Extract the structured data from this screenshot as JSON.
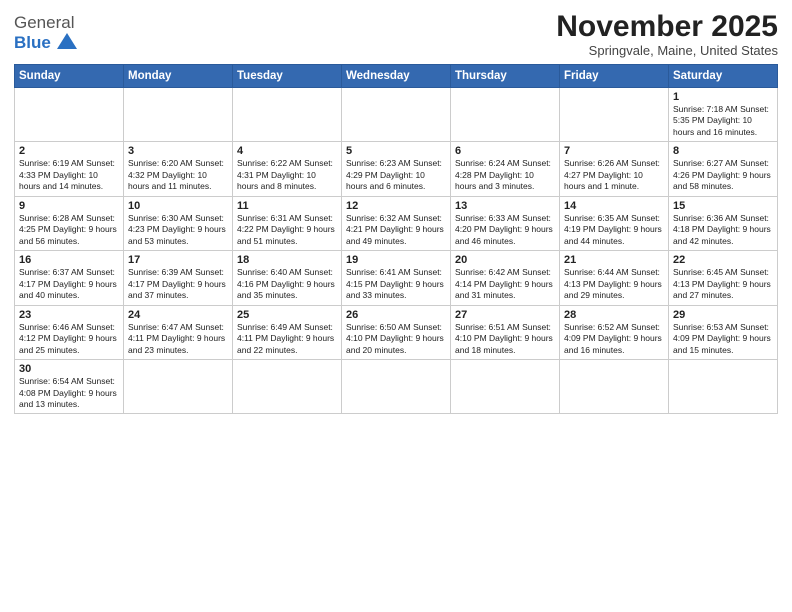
{
  "logo": {
    "text_general": "General",
    "text_blue": "Blue"
  },
  "title": "November 2025",
  "location": "Springvale, Maine, United States",
  "days_of_week": [
    "Sunday",
    "Monday",
    "Tuesday",
    "Wednesday",
    "Thursday",
    "Friday",
    "Saturday"
  ],
  "weeks": [
    [
      {
        "day": "",
        "info": ""
      },
      {
        "day": "",
        "info": ""
      },
      {
        "day": "",
        "info": ""
      },
      {
        "day": "",
        "info": ""
      },
      {
        "day": "",
        "info": ""
      },
      {
        "day": "",
        "info": ""
      },
      {
        "day": "1",
        "info": "Sunrise: 7:18 AM\nSunset: 5:35 PM\nDaylight: 10 hours\nand 16 minutes."
      }
    ],
    [
      {
        "day": "2",
        "info": "Sunrise: 6:19 AM\nSunset: 4:33 PM\nDaylight: 10 hours\nand 14 minutes."
      },
      {
        "day": "3",
        "info": "Sunrise: 6:20 AM\nSunset: 4:32 PM\nDaylight: 10 hours\nand 11 minutes."
      },
      {
        "day": "4",
        "info": "Sunrise: 6:22 AM\nSunset: 4:31 PM\nDaylight: 10 hours\nand 8 minutes."
      },
      {
        "day": "5",
        "info": "Sunrise: 6:23 AM\nSunset: 4:29 PM\nDaylight: 10 hours\nand 6 minutes."
      },
      {
        "day": "6",
        "info": "Sunrise: 6:24 AM\nSunset: 4:28 PM\nDaylight: 10 hours\nand 3 minutes."
      },
      {
        "day": "7",
        "info": "Sunrise: 6:26 AM\nSunset: 4:27 PM\nDaylight: 10 hours\nand 1 minute."
      },
      {
        "day": "8",
        "info": "Sunrise: 6:27 AM\nSunset: 4:26 PM\nDaylight: 9 hours\nand 58 minutes."
      }
    ],
    [
      {
        "day": "9",
        "info": "Sunrise: 6:28 AM\nSunset: 4:25 PM\nDaylight: 9 hours\nand 56 minutes."
      },
      {
        "day": "10",
        "info": "Sunrise: 6:30 AM\nSunset: 4:23 PM\nDaylight: 9 hours\nand 53 minutes."
      },
      {
        "day": "11",
        "info": "Sunrise: 6:31 AM\nSunset: 4:22 PM\nDaylight: 9 hours\nand 51 minutes."
      },
      {
        "day": "12",
        "info": "Sunrise: 6:32 AM\nSunset: 4:21 PM\nDaylight: 9 hours\nand 49 minutes."
      },
      {
        "day": "13",
        "info": "Sunrise: 6:33 AM\nSunset: 4:20 PM\nDaylight: 9 hours\nand 46 minutes."
      },
      {
        "day": "14",
        "info": "Sunrise: 6:35 AM\nSunset: 4:19 PM\nDaylight: 9 hours\nand 44 minutes."
      },
      {
        "day": "15",
        "info": "Sunrise: 6:36 AM\nSunset: 4:18 PM\nDaylight: 9 hours\nand 42 minutes."
      }
    ],
    [
      {
        "day": "16",
        "info": "Sunrise: 6:37 AM\nSunset: 4:17 PM\nDaylight: 9 hours\nand 40 minutes."
      },
      {
        "day": "17",
        "info": "Sunrise: 6:39 AM\nSunset: 4:17 PM\nDaylight: 9 hours\nand 37 minutes."
      },
      {
        "day": "18",
        "info": "Sunrise: 6:40 AM\nSunset: 4:16 PM\nDaylight: 9 hours\nand 35 minutes."
      },
      {
        "day": "19",
        "info": "Sunrise: 6:41 AM\nSunset: 4:15 PM\nDaylight: 9 hours\nand 33 minutes."
      },
      {
        "day": "20",
        "info": "Sunrise: 6:42 AM\nSunset: 4:14 PM\nDaylight: 9 hours\nand 31 minutes."
      },
      {
        "day": "21",
        "info": "Sunrise: 6:44 AM\nSunset: 4:13 PM\nDaylight: 9 hours\nand 29 minutes."
      },
      {
        "day": "22",
        "info": "Sunrise: 6:45 AM\nSunset: 4:13 PM\nDaylight: 9 hours\nand 27 minutes."
      }
    ],
    [
      {
        "day": "23",
        "info": "Sunrise: 6:46 AM\nSunset: 4:12 PM\nDaylight: 9 hours\nand 25 minutes."
      },
      {
        "day": "24",
        "info": "Sunrise: 6:47 AM\nSunset: 4:11 PM\nDaylight: 9 hours\nand 23 minutes."
      },
      {
        "day": "25",
        "info": "Sunrise: 6:49 AM\nSunset: 4:11 PM\nDaylight: 9 hours\nand 22 minutes."
      },
      {
        "day": "26",
        "info": "Sunrise: 6:50 AM\nSunset: 4:10 PM\nDaylight: 9 hours\nand 20 minutes."
      },
      {
        "day": "27",
        "info": "Sunrise: 6:51 AM\nSunset: 4:10 PM\nDaylight: 9 hours\nand 18 minutes."
      },
      {
        "day": "28",
        "info": "Sunrise: 6:52 AM\nSunset: 4:09 PM\nDaylight: 9 hours\nand 16 minutes."
      },
      {
        "day": "29",
        "info": "Sunrise: 6:53 AM\nSunset: 4:09 PM\nDaylight: 9 hours\nand 15 minutes."
      }
    ],
    [
      {
        "day": "30",
        "info": "Sunrise: 6:54 AM\nSunset: 4:08 PM\nDaylight: 9 hours\nand 13 minutes."
      },
      {
        "day": "",
        "info": ""
      },
      {
        "day": "",
        "info": ""
      },
      {
        "day": "",
        "info": ""
      },
      {
        "day": "",
        "info": ""
      },
      {
        "day": "",
        "info": ""
      },
      {
        "day": "",
        "info": ""
      }
    ]
  ]
}
